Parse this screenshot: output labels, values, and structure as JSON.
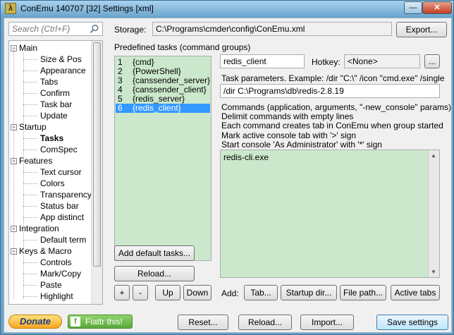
{
  "window": {
    "title": "ConEmu 140707 [32] Settings [xml]",
    "app_icon_glyph": "λ",
    "minimize_glyph": "—",
    "close_glyph": "✕"
  },
  "search": {
    "placeholder": "Search (Ctrl+F)",
    "value": ""
  },
  "tree": {
    "items": [
      {
        "label": "Main",
        "level": 0,
        "expanded": true
      },
      {
        "label": "Size & Pos",
        "level": 1
      },
      {
        "label": "Appearance",
        "level": 1
      },
      {
        "label": "Tabs",
        "level": 1
      },
      {
        "label": "Confirm",
        "level": 1
      },
      {
        "label": "Task bar",
        "level": 1
      },
      {
        "label": "Update",
        "level": 1
      },
      {
        "label": "Startup",
        "level": 0,
        "expanded": true
      },
      {
        "label": "Tasks",
        "level": 1,
        "selected": true
      },
      {
        "label": "ComSpec",
        "level": 1
      },
      {
        "label": "Features",
        "level": 0,
        "expanded": true
      },
      {
        "label": "Text cursor",
        "level": 1
      },
      {
        "label": "Colors",
        "level": 1
      },
      {
        "label": "Transparency",
        "level": 1
      },
      {
        "label": "Status bar",
        "level": 1
      },
      {
        "label": "App distinct",
        "level": 1
      },
      {
        "label": "Integration",
        "level": 0,
        "expanded": true
      },
      {
        "label": "Default term",
        "level": 1
      },
      {
        "label": "Keys & Macro",
        "level": 0,
        "expanded": true
      },
      {
        "label": "Controls",
        "level": 1
      },
      {
        "label": "Mark/Copy",
        "level": 1
      },
      {
        "label": "Paste",
        "level": 1
      },
      {
        "label": "Highlight",
        "level": 1
      }
    ]
  },
  "storage": {
    "label": "Storage:",
    "path": "C:\\Programs\\cmder\\config\\ConEmu.xml",
    "export_label": "Export..."
  },
  "tasks": {
    "header": "Predefined tasks (command groups)",
    "list": [
      {
        "num": "1",
        "name": "{cmd}"
      },
      {
        "num": "2",
        "name": "{PowerShell}"
      },
      {
        "num": "3",
        "name": "{canssender_server}"
      },
      {
        "num": "4",
        "name": "{canssender_client}"
      },
      {
        "num": "5",
        "name": "{redis_server}"
      },
      {
        "num": "6",
        "name": "{redis_client}",
        "selected": true
      }
    ],
    "add_default_label": "Add default tasks...",
    "reload_label": "Reload...",
    "plus_label": "+",
    "minus_label": "-",
    "up_label": "Up",
    "down_label": "Down"
  },
  "task_detail": {
    "name": "redis_client",
    "hotkey_label": "Hotkey:",
    "hotkey_value": "<None>",
    "hotkey_button": "...",
    "params_label": "Task parameters. Example: /dir \"C:\\\" /icon \"cmd.exe\" /single",
    "params_value": "/dir C:\\Programs\\db\\redis-2.8.19",
    "desc_lines": [
      "Commands (application, arguments, \"-new_console\" params)",
      "Delimit commands with empty lines",
      "Each command creates tab in ConEmu when group started",
      "Mark active console tab with '>' sign",
      "Start console 'As Administrator' with '*' sign"
    ],
    "commands": "redis-cli.exe",
    "add_label": "Add:",
    "add_tab": "Tab...",
    "add_startup_dir": "Startup dir...",
    "add_file_path": "File path...",
    "add_active_tabs": "Active tabs"
  },
  "footer": {
    "donate": "Donate",
    "flattr": "Flattr this!",
    "reset": "Reset...",
    "reload": "Reload...",
    "import": "Import...",
    "save": "Save settings"
  }
}
